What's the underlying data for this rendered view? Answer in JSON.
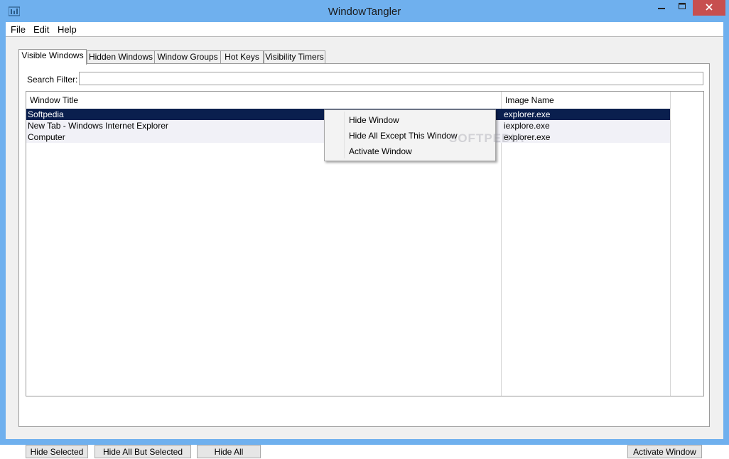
{
  "window": {
    "title": "WindowTangler"
  },
  "menu": [
    "File",
    "Edit",
    "Help"
  ],
  "tabs": [
    "Visible Windows",
    "Hidden Windows",
    "Window Groups",
    "Hot Keys",
    "Visibility Timers"
  ],
  "search": {
    "label": "Search Filter:",
    "value": ""
  },
  "table": {
    "columns": [
      "Window Title",
      "Image Name"
    ],
    "rows": [
      {
        "title": "Softpedia",
        "image": "explorer.exe"
      },
      {
        "title": "New Tab - Windows Internet Explorer",
        "image": "iexplore.exe"
      },
      {
        "title": "Computer",
        "image": "explorer.exe"
      }
    ]
  },
  "context_menu": [
    "Hide Window",
    "Hide All Except This Window",
    "Activate Window"
  ],
  "watermark": "SOFTPEDIA",
  "buttons": {
    "hide_selected": "Hide Selected",
    "hide_all_but_selected": "Hide All But Selected",
    "hide_all": "Hide All",
    "activate_window": "Activate Window"
  },
  "colors": {
    "selection": "#0a1f4e",
    "titlebar": "#6fb0ee",
    "close": "#c74f4f"
  }
}
